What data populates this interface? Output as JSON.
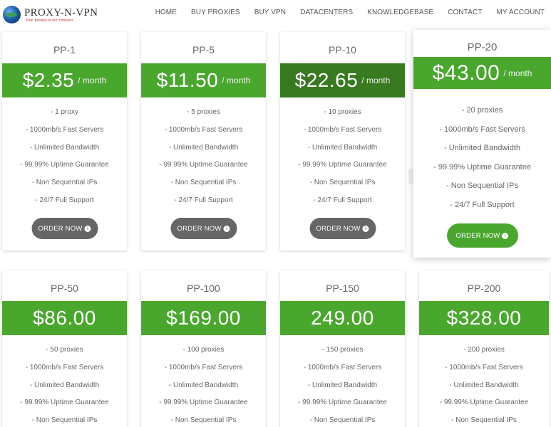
{
  "brand": {
    "title": "PROXY-N-VPN",
    "tagline": "Your privacy is our concern"
  },
  "nav": [
    "HOME",
    "BUY PROXIES",
    "BUY VPN",
    "DATACENTERS",
    "KNOWLEDGEBASE",
    "CONTACT",
    "MY ACCOUNT"
  ],
  "order_label": "ORDER NOW",
  "per_month": "/ month",
  "plans": [
    {
      "name": "PP-1",
      "price": "$2.35",
      "features": [
        "- 1 proxy",
        "- 1000mb/s Fast Servers",
        "- Unlimited Bandwidth",
        "- 99.99% Uptime Guarantee",
        "- Non Sequential IPs",
        "- 24/7 Full Support"
      ]
    },
    {
      "name": "PP-5",
      "price": "$11.50",
      "features": [
        "- 5 proxies",
        "- 1000mb/s Fast Servers",
        "- Unlimited Bandwidth",
        "- 99.99% Uptime Guarantee",
        "- Non Sequential IPs",
        "- 24/7 Full Support"
      ]
    },
    {
      "name": "PP-10",
      "price": "$22.65",
      "features": [
        "- 10 proxies",
        "- 1000mb/s Fast Servers",
        "- Unlimited Bandwidth",
        "- 99.99% Uptime Guarantee",
        "- Non Sequential IPs",
        "- 24/7 Full Support"
      ]
    },
    {
      "name": "PP-20",
      "price": "$43.00",
      "features": [
        "- 20 proxies",
        "- 1000mb/s Fast Servers",
        "- Unlimited Bandwidth",
        "- 99.99% Uptime Guarantee",
        "- Non Sequential IPs",
        "- 24/7 Full Support"
      ]
    },
    {
      "name": "PP-50",
      "price": "$86.00",
      "features": [
        "- 50 proxies",
        "- 1000mb/s Fast Servers",
        "- Unlimited Bandwidth",
        "- 99.99% Uptime Guarantee",
        "- Non Sequential IPs"
      ]
    },
    {
      "name": "PP-100",
      "price": "$169.00",
      "features": [
        "- 100 proxies",
        "- 1000mb/s Fast Servers",
        "- Unlimited Bandwidth",
        "- 99.99% Uptime Guarantee",
        "- Non Sequential IPs"
      ]
    },
    {
      "name": "PP-150",
      "price": "249.00",
      "features": [
        "- 150 proxies",
        "- 1000mb/s Fast Servers",
        "- Unlimited Bandwidth",
        "- 99.99% Uptime Guarantee",
        "- Non Sequential IPs"
      ]
    },
    {
      "name": "PP-200",
      "price": "$328.00",
      "features": [
        "- 200 proxies",
        "- 1000mb/s Fast Servers",
        "- Unlimited Bandwidth",
        "- 99.99% Uptime Guarantee",
        "- Non Sequential IPs"
      ]
    }
  ],
  "colors": {
    "accent": "#4aa72e",
    "accent_dark": "#377a20",
    "button": "#666666"
  }
}
